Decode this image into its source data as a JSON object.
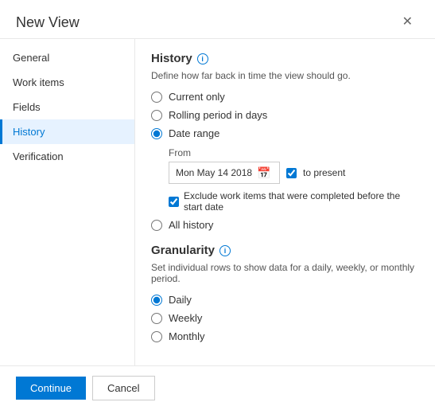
{
  "dialog": {
    "title": "New View",
    "close_label": "✕"
  },
  "sidebar": {
    "items": [
      {
        "id": "general",
        "label": "General",
        "active": false
      },
      {
        "id": "work-items",
        "label": "Work items",
        "active": false
      },
      {
        "id": "fields",
        "label": "Fields",
        "active": false
      },
      {
        "id": "history",
        "label": "History",
        "active": true
      },
      {
        "id": "verification",
        "label": "Verification",
        "active": false
      }
    ]
  },
  "history": {
    "section_title": "History",
    "info_icon": "i",
    "description": "Define how far back in time the view should go.",
    "options": [
      {
        "id": "current-only",
        "label": "Current only",
        "checked": false
      },
      {
        "id": "rolling-period",
        "label": "Rolling period in days",
        "checked": false
      },
      {
        "id": "date-range",
        "label": "Date range",
        "checked": true
      },
      {
        "id": "all-history",
        "label": "All history",
        "checked": false
      }
    ],
    "from_label": "From",
    "date_value": "Mon May 14 2018",
    "to_present_label": "to present",
    "exclude_label": "Exclude work items that were completed before the start date"
  },
  "granularity": {
    "section_title": "Granularity",
    "info_icon": "i",
    "description": "Set individual rows to show data for a daily, weekly, or monthly period.",
    "options": [
      {
        "id": "daily",
        "label": "Daily",
        "checked": true
      },
      {
        "id": "weekly",
        "label": "Weekly",
        "checked": false
      },
      {
        "id": "monthly",
        "label": "Monthly",
        "checked": false
      }
    ]
  },
  "footer": {
    "continue_label": "Continue",
    "cancel_label": "Cancel"
  }
}
